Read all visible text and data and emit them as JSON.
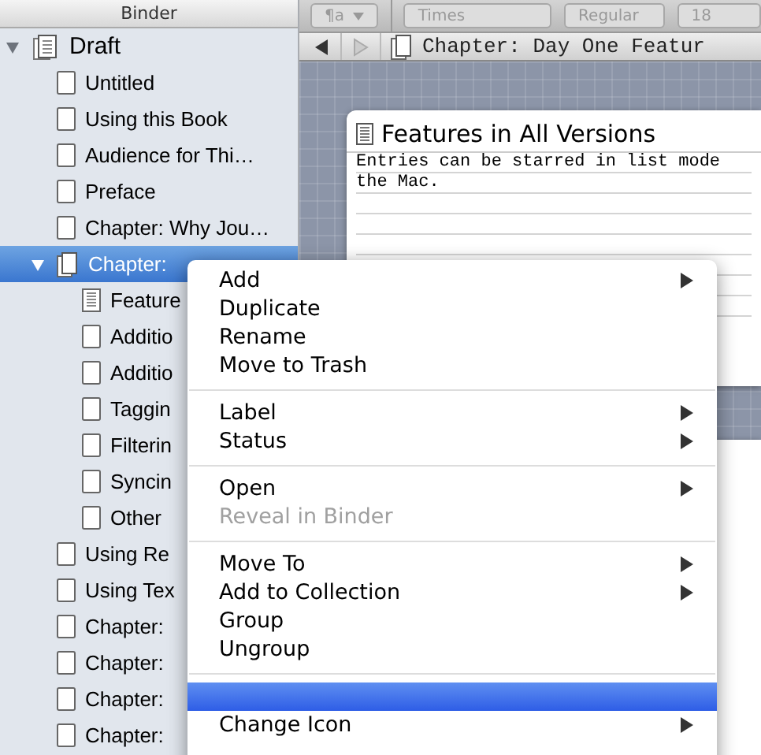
{
  "binder": {
    "title": "Binder",
    "items": [
      {
        "label": "Draft",
        "kind": "stack",
        "expanded": true,
        "selected": false,
        "children": [
          {
            "label": "Untitled",
            "kind": "page",
            "selected": false
          },
          {
            "label": "Using this Book",
            "kind": "page",
            "selected": false
          },
          {
            "label": "Audience for Thi…",
            "kind": "page",
            "selected": false
          },
          {
            "label": "Preface",
            "kind": "page",
            "selected": false
          },
          {
            "label": "Chapter: Why Jou…",
            "kind": "page",
            "selected": false
          },
          {
            "label": "Chapter:",
            "kind": "pages",
            "expanded": true,
            "selected": true,
            "children": [
              {
                "label": "Feature",
                "kind": "text",
                "selected": false
              },
              {
                "label": "Additio",
                "kind": "page",
                "selected": false
              },
              {
                "label": "Additio",
                "kind": "page",
                "selected": false
              },
              {
                "label": "Taggin",
                "kind": "page",
                "selected": false
              },
              {
                "label": "Filterin",
                "kind": "page",
                "selected": false
              },
              {
                "label": "Syncin",
                "kind": "page",
                "selected": false
              },
              {
                "label": "Other",
                "kind": "page",
                "selected": false
              }
            ]
          },
          {
            "label": "Using Re",
            "kind": "page",
            "selected": false
          },
          {
            "label": "Using Tex",
            "kind": "page",
            "selected": false
          },
          {
            "label": "Chapter:",
            "kind": "page",
            "selected": false
          },
          {
            "label": "Chapter:",
            "kind": "page",
            "selected": false
          },
          {
            "label": "Chapter:",
            "kind": "page",
            "selected": false
          },
          {
            "label": "Chapter:",
            "kind": "page",
            "selected": false
          }
        ]
      }
    ]
  },
  "format_bar": {
    "style_popup": "¶a",
    "font": "Times",
    "weight": "Regular",
    "size": "18"
  },
  "header": {
    "title": "Chapter: Day One Featur"
  },
  "card": {
    "title": "Features in All Versions",
    "lines": [
      "Entries can be starred in list mode",
      "the Mac."
    ]
  },
  "context_menu": [
    {
      "kind": "item",
      "label": "Add",
      "submenu": true,
      "disabled": false,
      "selected": false
    },
    {
      "kind": "item",
      "label": "Duplicate",
      "submenu": false,
      "disabled": false,
      "selected": false
    },
    {
      "kind": "item",
      "label": "Rename",
      "submenu": false,
      "disabled": false,
      "selected": false
    },
    {
      "kind": "item",
      "label": "Move to Trash",
      "submenu": false,
      "disabled": false,
      "selected": false
    },
    {
      "kind": "separator"
    },
    {
      "kind": "item",
      "label": "Label",
      "submenu": true,
      "disabled": false,
      "selected": false
    },
    {
      "kind": "item",
      "label": "Status",
      "submenu": true,
      "disabled": false,
      "selected": false
    },
    {
      "kind": "separator"
    },
    {
      "kind": "item",
      "label": "Open",
      "submenu": true,
      "disabled": false,
      "selected": false
    },
    {
      "kind": "item",
      "label": "Reveal in Binder",
      "submenu": false,
      "disabled": true,
      "selected": false
    },
    {
      "kind": "separator"
    },
    {
      "kind": "item",
      "label": "Move To",
      "submenu": true,
      "disabled": false,
      "selected": false
    },
    {
      "kind": "item",
      "label": "Add to Collection",
      "submenu": true,
      "disabled": false,
      "selected": false
    },
    {
      "kind": "item",
      "label": "Group",
      "submenu": false,
      "disabled": false,
      "selected": false
    },
    {
      "kind": "item",
      "label": "Ungroup",
      "submenu": false,
      "disabled": false,
      "selected": false
    },
    {
      "kind": "separator"
    },
    {
      "kind": "item",
      "submenu": false,
      "disabled": false,
      "selected": true
    },
    {
      "kind": "item",
      "label": "Change Icon",
      "submenu": true,
      "disabled": false,
      "selected": false
    }
  ]
}
